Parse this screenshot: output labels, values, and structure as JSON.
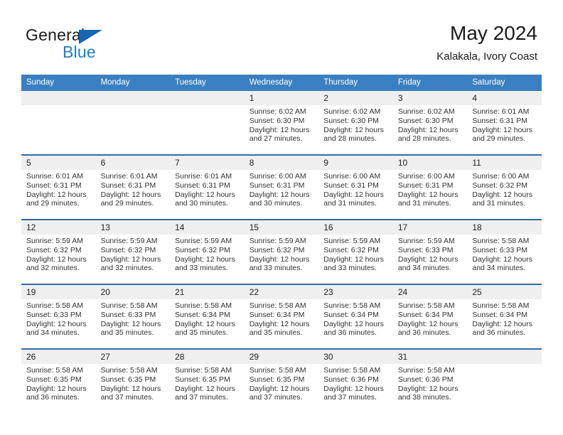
{
  "brand": {
    "name_part1": "General",
    "name_part2": "Blue",
    "logo_icon": "triangle-logo-icon"
  },
  "header": {
    "title": "May 2024",
    "subtitle": "Kalakala, Ivory Coast"
  },
  "colors": {
    "header_band": "#3a7fc1",
    "row_separator": "#2e6da4",
    "daynum_band": "#efefef",
    "brand_blue": "#1d7fd0",
    "text": "#333333"
  },
  "calendar": {
    "day_headers": [
      "Sunday",
      "Monday",
      "Tuesday",
      "Wednesday",
      "Thursday",
      "Friday",
      "Saturday"
    ],
    "labels": {
      "sunrise": "Sunrise:",
      "sunset": "Sunset:",
      "daylight": "Daylight:"
    },
    "weeks": [
      [
        {
          "day": "",
          "empty": true
        },
        {
          "day": "",
          "empty": true
        },
        {
          "day": "",
          "empty": true
        },
        {
          "day": "1",
          "sunrise": "Sunrise: 6:02 AM",
          "sunset": "Sunset: 6:30 PM",
          "daylight": "Daylight: 12 hours and 27 minutes."
        },
        {
          "day": "2",
          "sunrise": "Sunrise: 6:02 AM",
          "sunset": "Sunset: 6:30 PM",
          "daylight": "Daylight: 12 hours and 28 minutes."
        },
        {
          "day": "3",
          "sunrise": "Sunrise: 6:02 AM",
          "sunset": "Sunset: 6:30 PM",
          "daylight": "Daylight: 12 hours and 28 minutes."
        },
        {
          "day": "4",
          "sunrise": "Sunrise: 6:01 AM",
          "sunset": "Sunset: 6:31 PM",
          "daylight": "Daylight: 12 hours and 29 minutes."
        }
      ],
      [
        {
          "day": "5",
          "sunrise": "Sunrise: 6:01 AM",
          "sunset": "Sunset: 6:31 PM",
          "daylight": "Daylight: 12 hours and 29 minutes."
        },
        {
          "day": "6",
          "sunrise": "Sunrise: 6:01 AM",
          "sunset": "Sunset: 6:31 PM",
          "daylight": "Daylight: 12 hours and 29 minutes."
        },
        {
          "day": "7",
          "sunrise": "Sunrise: 6:01 AM",
          "sunset": "Sunset: 6:31 PM",
          "daylight": "Daylight: 12 hours and 30 minutes."
        },
        {
          "day": "8",
          "sunrise": "Sunrise: 6:00 AM",
          "sunset": "Sunset: 6:31 PM",
          "daylight": "Daylight: 12 hours and 30 minutes."
        },
        {
          "day": "9",
          "sunrise": "Sunrise: 6:00 AM",
          "sunset": "Sunset: 6:31 PM",
          "daylight": "Daylight: 12 hours and 31 minutes."
        },
        {
          "day": "10",
          "sunrise": "Sunrise: 6:00 AM",
          "sunset": "Sunset: 6:31 PM",
          "daylight": "Daylight: 12 hours and 31 minutes."
        },
        {
          "day": "11",
          "sunrise": "Sunrise: 6:00 AM",
          "sunset": "Sunset: 6:32 PM",
          "daylight": "Daylight: 12 hours and 31 minutes."
        }
      ],
      [
        {
          "day": "12",
          "sunrise": "Sunrise: 5:59 AM",
          "sunset": "Sunset: 6:32 PM",
          "daylight": "Daylight: 12 hours and 32 minutes."
        },
        {
          "day": "13",
          "sunrise": "Sunrise: 5:59 AM",
          "sunset": "Sunset: 6:32 PM",
          "daylight": "Daylight: 12 hours and 32 minutes."
        },
        {
          "day": "14",
          "sunrise": "Sunrise: 5:59 AM",
          "sunset": "Sunset: 6:32 PM",
          "daylight": "Daylight: 12 hours and 33 minutes."
        },
        {
          "day": "15",
          "sunrise": "Sunrise: 5:59 AM",
          "sunset": "Sunset: 6:32 PM",
          "daylight": "Daylight: 12 hours and 33 minutes."
        },
        {
          "day": "16",
          "sunrise": "Sunrise: 5:59 AM",
          "sunset": "Sunset: 6:32 PM",
          "daylight": "Daylight: 12 hours and 33 minutes."
        },
        {
          "day": "17",
          "sunrise": "Sunrise: 5:59 AM",
          "sunset": "Sunset: 6:33 PM",
          "daylight": "Daylight: 12 hours and 34 minutes."
        },
        {
          "day": "18",
          "sunrise": "Sunrise: 5:58 AM",
          "sunset": "Sunset: 6:33 PM",
          "daylight": "Daylight: 12 hours and 34 minutes."
        }
      ],
      [
        {
          "day": "19",
          "sunrise": "Sunrise: 5:58 AM",
          "sunset": "Sunset: 6:33 PM",
          "daylight": "Daylight: 12 hours and 34 minutes."
        },
        {
          "day": "20",
          "sunrise": "Sunrise: 5:58 AM",
          "sunset": "Sunset: 6:33 PM",
          "daylight": "Daylight: 12 hours and 35 minutes."
        },
        {
          "day": "21",
          "sunrise": "Sunrise: 5:58 AM",
          "sunset": "Sunset: 6:34 PM",
          "daylight": "Daylight: 12 hours and 35 minutes."
        },
        {
          "day": "22",
          "sunrise": "Sunrise: 5:58 AM",
          "sunset": "Sunset: 6:34 PM",
          "daylight": "Daylight: 12 hours and 35 minutes."
        },
        {
          "day": "23",
          "sunrise": "Sunrise: 5:58 AM",
          "sunset": "Sunset: 6:34 PM",
          "daylight": "Daylight: 12 hours and 36 minutes."
        },
        {
          "day": "24",
          "sunrise": "Sunrise: 5:58 AM",
          "sunset": "Sunset: 6:34 PM",
          "daylight": "Daylight: 12 hours and 36 minutes."
        },
        {
          "day": "25",
          "sunrise": "Sunrise: 5:58 AM",
          "sunset": "Sunset: 6:34 PM",
          "daylight": "Daylight: 12 hours and 36 minutes."
        }
      ],
      [
        {
          "day": "26",
          "sunrise": "Sunrise: 5:58 AM",
          "sunset": "Sunset: 6:35 PM",
          "daylight": "Daylight: 12 hours and 36 minutes."
        },
        {
          "day": "27",
          "sunrise": "Sunrise: 5:58 AM",
          "sunset": "Sunset: 6:35 PM",
          "daylight": "Daylight: 12 hours and 37 minutes."
        },
        {
          "day": "28",
          "sunrise": "Sunrise: 5:58 AM",
          "sunset": "Sunset: 6:35 PM",
          "daylight": "Daylight: 12 hours and 37 minutes."
        },
        {
          "day": "29",
          "sunrise": "Sunrise: 5:58 AM",
          "sunset": "Sunset: 6:35 PM",
          "daylight": "Daylight: 12 hours and 37 minutes."
        },
        {
          "day": "30",
          "sunrise": "Sunrise: 5:58 AM",
          "sunset": "Sunset: 6:36 PM",
          "daylight": "Daylight: 12 hours and 37 minutes."
        },
        {
          "day": "31",
          "sunrise": "Sunrise: 5:58 AM",
          "sunset": "Sunset: 6:36 PM",
          "daylight": "Daylight: 12 hours and 38 minutes."
        },
        {
          "day": "",
          "empty": true
        }
      ]
    ]
  }
}
